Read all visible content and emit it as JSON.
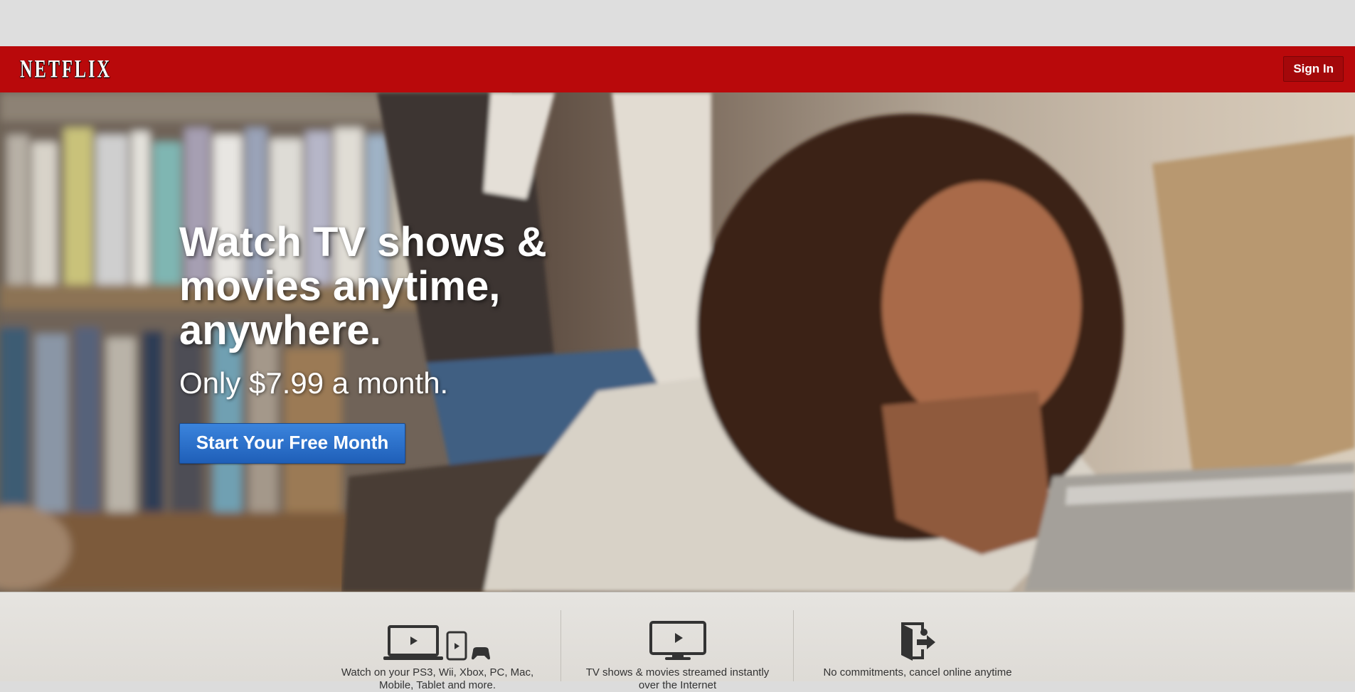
{
  "header": {
    "logo_text": "NETFLIX",
    "sign_in_label": "Sign In"
  },
  "hero": {
    "headline": "Watch TV shows & movies anytime, anywhere.",
    "subline": "Only $7.99 a month.",
    "cta_label": "Start Your Free Month"
  },
  "features": [
    {
      "icon": "devices-icon",
      "caption": "Watch on your PS3, Wii, Xbox, PC, Mac, Mobile, Tablet and more."
    },
    {
      "icon": "tv-icon",
      "caption": "TV shows & movies streamed instantly over the Internet"
    },
    {
      "icon": "exit-door-icon",
      "caption": "No commitments, cancel online anytime"
    }
  ],
  "colors": {
    "header_red": "#b9090b",
    "cta_blue": "#2a6fcb",
    "feature_bar": "#e3e1dd"
  }
}
